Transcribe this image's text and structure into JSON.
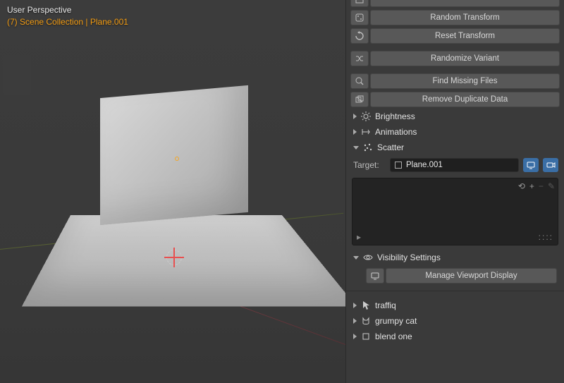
{
  "viewport": {
    "view_name": "User Perspective",
    "collection_num": "(7)",
    "collection_label": "Scene Collection",
    "separator": "|",
    "active_object": "Plane.001"
  },
  "panel": {
    "cutoff_button": "",
    "buttons": {
      "random_transform": "Random Transform",
      "reset_transform": "Reset Transform",
      "randomize_variant": "Randomize Variant",
      "find_missing": "Find Missing Files",
      "remove_dupes": "Remove Duplicate Data"
    },
    "sections": {
      "brightness": "Brightness",
      "animations": "Animations",
      "scatter": "Scatter",
      "visibility": "Visibility Settings"
    },
    "scatter": {
      "target_label": "Target:",
      "target_value": "Plane.001",
      "list_tools": {
        "link": "⟲",
        "add": "+",
        "remove": "−",
        "edit": "✎"
      },
      "list_footer_left": "▸",
      "list_footer_right": "::::"
    },
    "visibility": {
      "manage_viewport": "Manage Viewport Display"
    },
    "addons": {
      "traffiq": "traffiq",
      "grumpy": "grumpy cat",
      "blend_one": "blend one"
    }
  }
}
